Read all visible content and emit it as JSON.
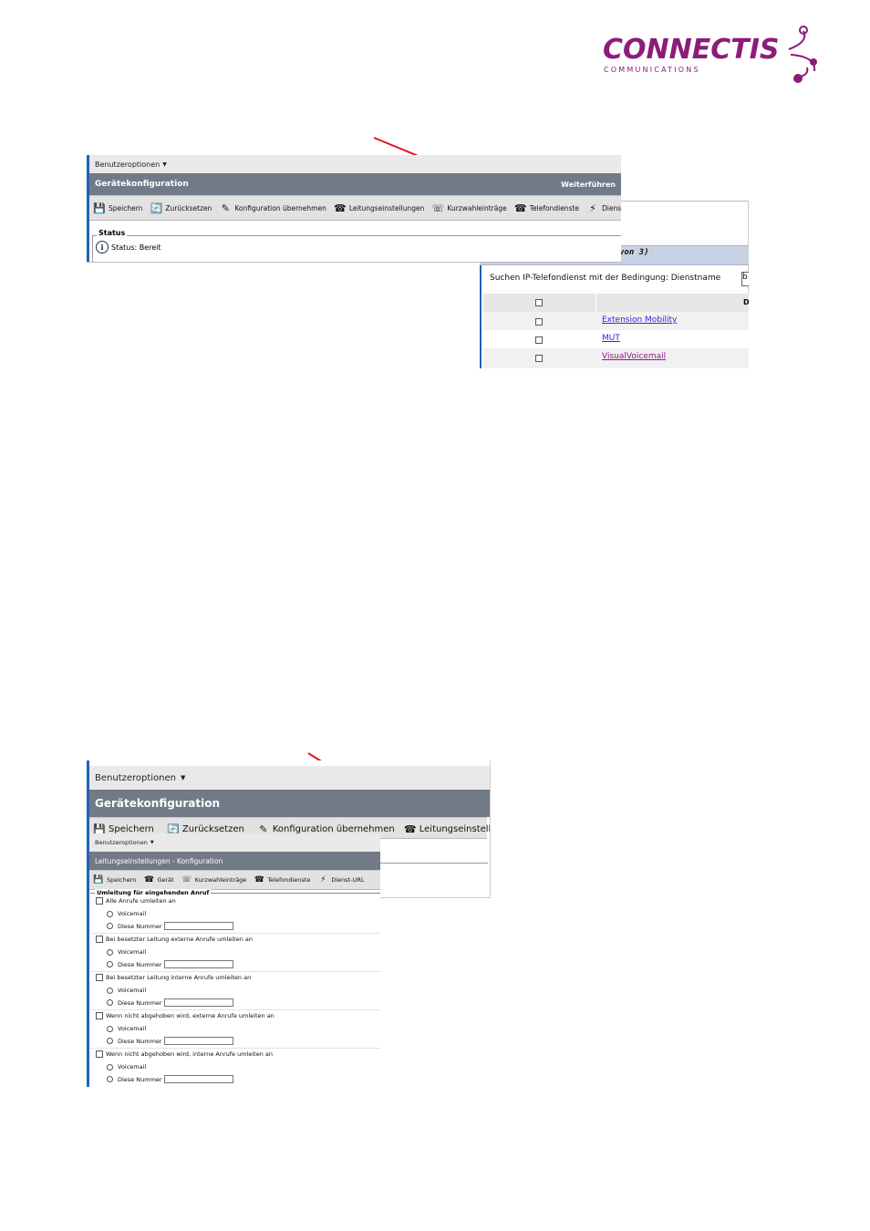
{
  "logo": {
    "brand": "CONNECTIS",
    "sub": "COMMUNICATIONS"
  },
  "shot1": {
    "menu": "Benutzeroptionen",
    "title": "Gerätekonfiguration",
    "title_right": "Weiterführen",
    "toolbar": [
      "Speichern",
      "Zurücksetzen",
      "Konfiguration übernehmen",
      "Leitungseinstellungen",
      "Kurzwahleinträge",
      "Telefondienste",
      "Dienst-URL"
    ],
    "status_legend": "Status",
    "status_text": "Status: Bereit"
  },
  "shot2": {
    "header_fragment": "von 3)",
    "search_label": "Suchen IP-Telefondienst mit der Bedingung: Dienstname",
    "search_value": "b",
    "col_fragment": "D",
    "services": [
      "Extension Mobility",
      "MUT",
      "VisualVoicemail"
    ]
  },
  "shot3": {
    "menu": "Benutzeroptionen",
    "title": "Gerätekonfiguration",
    "toolbar": [
      "Speichern",
      "Zurücksetzen",
      "Konfiguration übernehmen",
      "Leitungseinstellungen"
    ]
  },
  "shot4": {
    "menu": "Benutzeroptionen",
    "title": "Leitungseinstellungen - Konfiguration",
    "toolbar": [
      "Speichern",
      "Gerät",
      "Kurzwahleinträge",
      "Telefondienste",
      "Dienst-URL"
    ],
    "section": "Umleitung für eingehenden Anruf",
    "groups": [
      "Alle Anrufe umleiten an",
      "Bei besetzter Leitung externe Anrufe umleiten an",
      "Bei besetzter Leitung interne Anrufe umleiten an",
      "Wenn nicht abgehoben wird, externe Anrufe umleiten an",
      "Wenn nicht abgehoben wird, interne Anrufe umleiten an"
    ],
    "opt_voicemail": "Voicemail",
    "opt_number": "Diese Nummer"
  },
  "colors": {
    "brand": "#8c1c7a",
    "arrow": "#e0141e",
    "titlebar": "#717a86"
  }
}
